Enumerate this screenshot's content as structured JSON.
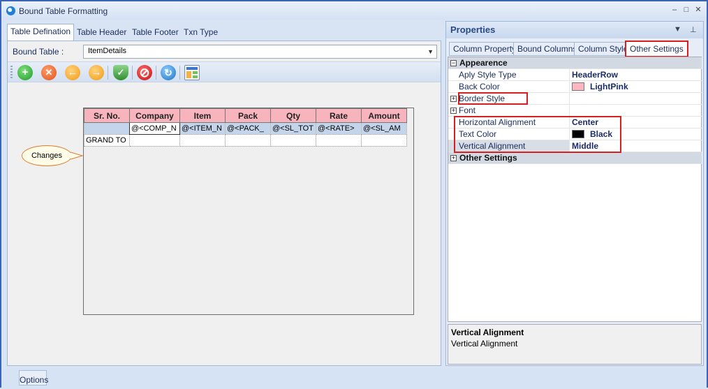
{
  "window": {
    "title": "Bound Table Formatting",
    "controls": [
      "–",
      "□",
      "✕"
    ]
  },
  "left": {
    "tabs": [
      "Table Defination",
      "Table Header",
      "Table Footer",
      "Txn Type"
    ],
    "bound_table_label": "Bound Table :",
    "bound_table_value": "ItemDetails",
    "toolbar_icons": [
      "add-icon",
      "delete-icon",
      "back-icon",
      "forward-icon",
      "shield-check-icon",
      "no-entry-icon",
      "refresh-icon",
      "layout-icon"
    ]
  },
  "callout": "Changes",
  "grid": {
    "headers": [
      "Sr. No.",
      "Company",
      "Item",
      "Pack",
      "Qty",
      "Rate",
      "Amount"
    ],
    "data_row": [
      "",
      "@<COMP_N",
      "@<ITEM_N",
      "@<PACK_",
      "@<SL_TOT",
      "@<RATE>",
      "@<SL_AM"
    ],
    "total_row": [
      "GRAND TO",
      "",
      "",
      "",
      "",
      "",
      ""
    ]
  },
  "props": {
    "title": "Properties",
    "tabs": [
      "Column Property",
      "Bound Columns",
      "Column Style",
      "Other Settings"
    ],
    "rows": [
      {
        "type": "cat",
        "name": "Appearence",
        "expander": "−"
      },
      {
        "type": "prop",
        "name": "Aply Style Type",
        "value": "HeaderRow"
      },
      {
        "type": "prop",
        "name": "Back Color",
        "value": "LightPink",
        "swatch": "#ffb6c1"
      },
      {
        "type": "prop",
        "name": "Border Style",
        "value": "",
        "expander": "+"
      },
      {
        "type": "prop",
        "name": "Font",
        "value": "",
        "expander": "+"
      },
      {
        "type": "prop",
        "name": "Horizontal Alignment",
        "value": "Center"
      },
      {
        "type": "prop",
        "name": "Text Color",
        "value": "Black",
        "swatch": "#000000"
      },
      {
        "type": "prop",
        "name": "Vertical Alignment",
        "value": "Middle",
        "selected": true
      },
      {
        "type": "cat",
        "name": "Other Settings",
        "expander": "+"
      }
    ],
    "description_title": "Vertical Alignment",
    "description_text": "Vertical Alignment"
  },
  "status": {
    "options_label": "Options"
  },
  "colors": {
    "header_pink": "#f8b4bc",
    "highlight_red": "#d42020",
    "accent_blue": "#2a4a86"
  }
}
